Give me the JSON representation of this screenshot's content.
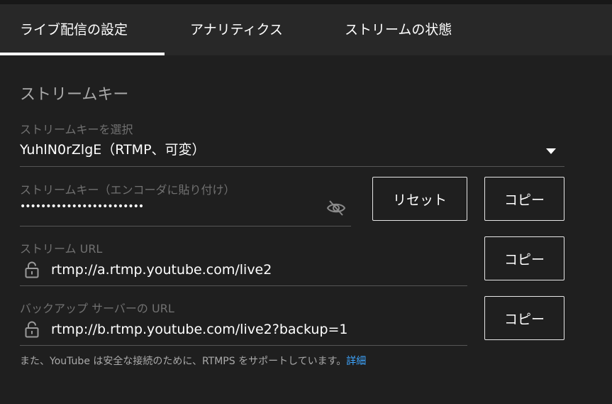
{
  "tabs": [
    {
      "label": "ライブ配信の設定",
      "active": true
    },
    {
      "label": "アナリティクス",
      "active": false
    },
    {
      "label": "ストリームの状態",
      "active": false
    }
  ],
  "stream_key_section": {
    "title": "ストリームキー",
    "select_label": "ストリームキーを選択",
    "select_value": "YuhlN0rZlgE（RTMP、可変）",
    "key_label": "ストリームキー（エンコーダに貼り付け）",
    "key_masked": "••••••••••••••••••••••••",
    "reset_label": "リセット",
    "copy_label": "コピー",
    "url_label": "ストリーム URL",
    "url_value": "rtmp://a.rtmp.youtube.com/live2",
    "backup_label": "バックアップ サーバーの URL",
    "backup_value": "rtmp://b.rtmp.youtube.com/live2?backup=1",
    "footnote": "また、YouTube は安全な接続のために、RTMPS をサポートしています。",
    "footnote_link": "詳細"
  },
  "icons": [
    "visibility-off-icon",
    "lock-icon",
    "dropdown-arrow-icon"
  ],
  "colors": {
    "background": "#1f1f1f",
    "tabbar": "#282828",
    "link": "#3ea6ff",
    "label": "#717171"
  }
}
